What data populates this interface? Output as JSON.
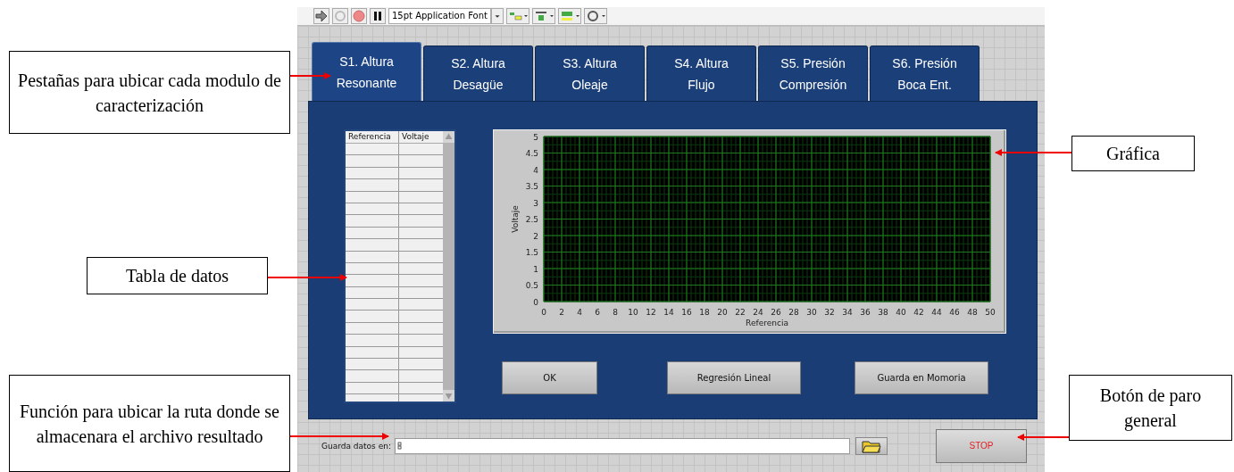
{
  "toolbar": {
    "font_menu": "15pt Application Font"
  },
  "tabs": [
    {
      "title": "S1. Altura",
      "subtitle": "Resonante",
      "selected": true
    },
    {
      "title": "S2. Altura",
      "subtitle": "Desagüe",
      "selected": false
    },
    {
      "title": "S3. Altura",
      "subtitle": "Oleaje",
      "selected": false
    },
    {
      "title": "S4. Altura",
      "subtitle": "Flujo",
      "selected": false
    },
    {
      "title": "S5. Presión",
      "subtitle": "Compresión",
      "selected": false
    },
    {
      "title": "S6. Presión",
      "subtitle": "Boca Ent.",
      "selected": false
    }
  ],
  "table": {
    "columns": [
      "Referencia",
      "Voltaje"
    ]
  },
  "graph": {
    "chart_data": {
      "type": "line",
      "xlabel": "Referencia",
      "ylabel": "Voltaje",
      "xlim": [
        0,
        50
      ],
      "ylim": [
        0,
        5
      ],
      "xticks": [
        0,
        2,
        4,
        6,
        8,
        10,
        12,
        14,
        16,
        18,
        20,
        22,
        24,
        26,
        28,
        30,
        32,
        34,
        36,
        38,
        40,
        42,
        44,
        46,
        48,
        50
      ],
      "yticks": [
        0,
        0.5,
        1,
        1.5,
        2,
        2.5,
        3,
        3.5,
        4,
        4.5,
        5
      ],
      "grid": true
    }
  },
  "buttons": [
    "OK",
    "Regresión Lineal",
    "Guarda en Momoria"
  ],
  "path_field": {
    "label": "Guarda datos en:"
  },
  "stop_button": "STOP",
  "annotations": [
    {
      "text": "Pestañas para ubicar cada modulo de caracterización"
    },
    {
      "text": "Tabla de datos"
    },
    {
      "text": "Función para ubicar la ruta donde se almacenara el archivo resultado"
    },
    {
      "text": "Gráfica"
    },
    {
      "text": "Botón de paro general"
    }
  ]
}
